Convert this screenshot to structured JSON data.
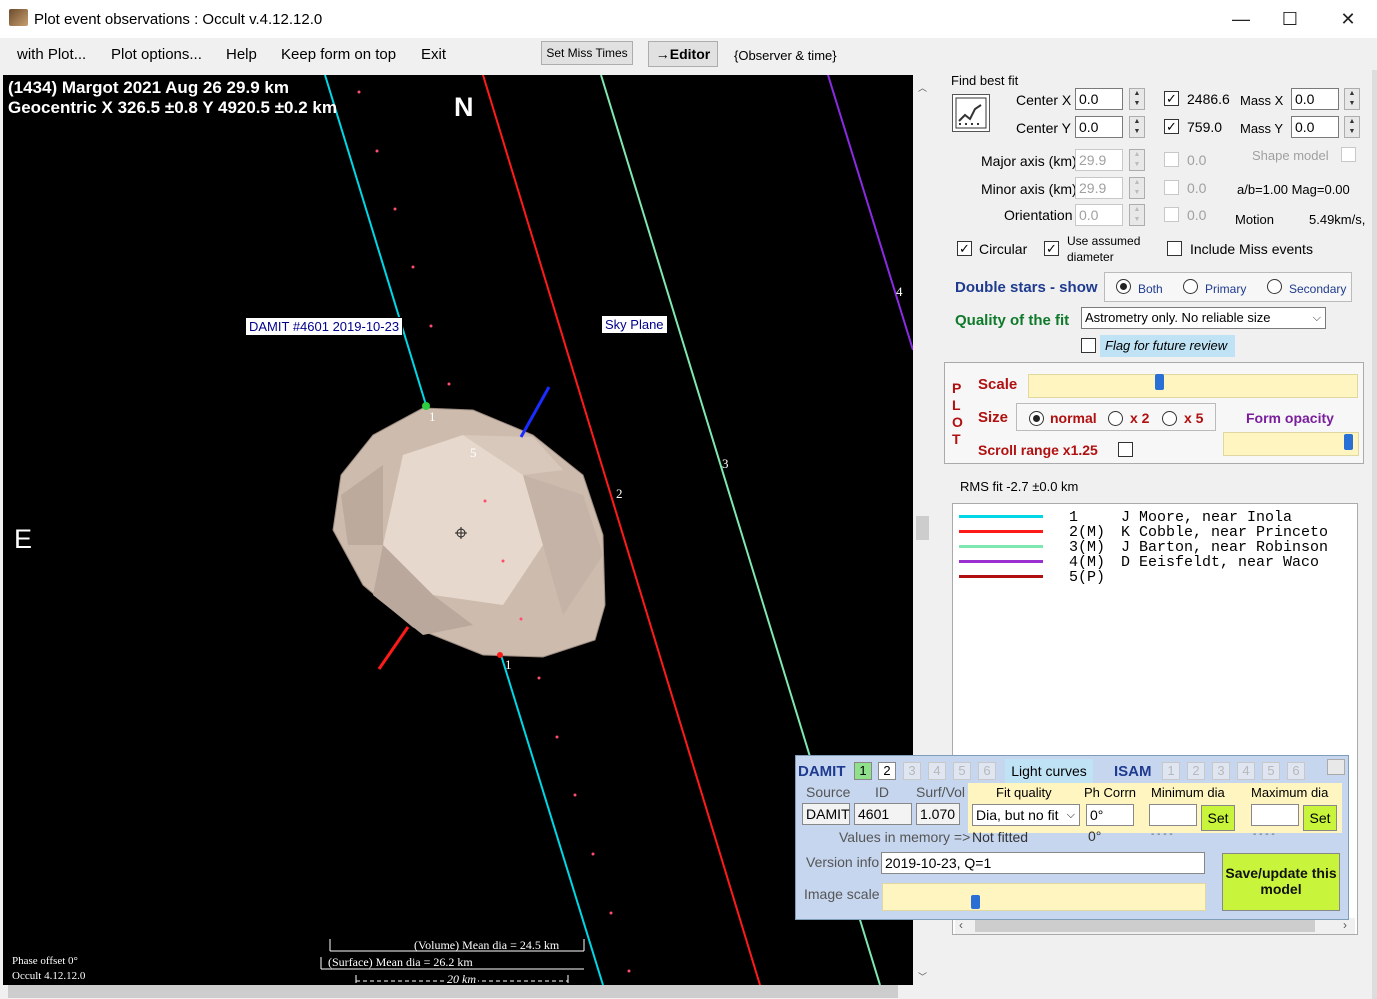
{
  "window": {
    "title": "Plot event observations : Occult v.4.12.12.0",
    "minimize": "—",
    "maximize": "☐",
    "close": "✕"
  },
  "menu": {
    "items": [
      "with Plot...",
      "Plot options...",
      "Help",
      "Keep form on top",
      "Exit"
    ],
    "set_miss_times": "Set Miss Times",
    "editor": "→Editor",
    "observer_time": "{Observer & time}"
  },
  "plot": {
    "header_line1": "(1434) Margot  2021 Aug 26   29.9 km",
    "header_line2": "Geocentric  X  326.5 ±0.8  Y 4920.5 ±0.2 km",
    "north": "N",
    "east": "E",
    "damit_label": "DAMIT #4601 2019-10-23",
    "sky_plane": "Sky Plane",
    "chord_labels": [
      "1",
      "2",
      "3",
      "4",
      "5",
      "1"
    ],
    "volume_dia": "(Volume) Mean dia = 24.5 km",
    "surface_dia": "(Surface) Mean dia = 26.2 km",
    "scale_bar": "20 km",
    "phase_offset": "Phase offset 0°",
    "version": "Occult 4.12.12.0",
    "colors": {
      "chord1": "#00d7e6",
      "chord2": "#ff1a1a",
      "chord3": "#7fe8b0",
      "chord4": "#8a2be2",
      "asteroid": "#cdbcae"
    }
  },
  "fit": {
    "find_best_fit": "Find best fit",
    "center_x_label": "Center X",
    "center_x": "0.0",
    "center_y_label": "Center Y",
    "center_y": "0.0",
    "val_x": "2486.6",
    "val_y": "759.0",
    "mass_x_label": "Mass X",
    "mass_x": "0.0",
    "mass_y_label": "Mass Y",
    "mass_y": "0.0",
    "major_axis_label": "Major axis (km)",
    "major_axis": "29.9",
    "minor_axis_label": "Minor axis (km)",
    "minor_axis": "29.9",
    "orientation_label": "Orientation",
    "orientation": "0.0",
    "dim_vals": [
      "0.0",
      "0.0",
      "0.0"
    ],
    "shape_model": "Shape model",
    "ab_mag": "a/b=1.00  Mag=0.00",
    "motion_label": "Motion",
    "motion": "5.49km/s,",
    "circular": "Circular",
    "use_assumed": "Use assumed",
    "diameter": "diameter",
    "include_miss": "Include Miss events"
  },
  "double_stars": {
    "label": "Double stars - show",
    "both": "Both",
    "primary": "Primary",
    "secondary": "Secondary"
  },
  "quality": {
    "label": "Quality of the fit",
    "value": "Astrometry only. No reliable size",
    "flag": "Flag for future review"
  },
  "plot_box": {
    "plot_letters": [
      "P",
      "L",
      "O",
      "T"
    ],
    "scale": "Scale",
    "size": "Size",
    "normal": "normal",
    "x2": "x 2",
    "x5": "x 5",
    "form_opacity": "Form opacity",
    "scroll_range": "Scroll range x1.25"
  },
  "rms": "RMS fit -2.7 ±0.0 km",
  "legend": [
    {
      "num": "1    ",
      "name": "J Moore, near Inola",
      "color": "#00d7e6"
    },
    {
      "num": "2(M) ",
      "name": "K Cobble, near Princeto",
      "color": "#ff1a1a"
    },
    {
      "num": "3(M) ",
      "name": "J Barton, near Robinson",
      "color": "#7fe8b0"
    },
    {
      "num": "4(M) ",
      "name": "D Eeisfeldt, near Waco",
      "color": "#9b30d0"
    },
    {
      "num": "5(P) ",
      "name": "",
      "color": "#b01010"
    }
  ],
  "damit": {
    "title": "DAMIT",
    "tabs": [
      "1",
      "2",
      "3",
      "4",
      "5",
      "6"
    ],
    "light_curves": "Light curves",
    "isam": "ISAM",
    "isam_tabs": [
      "1",
      "2",
      "3",
      "4",
      "5",
      "6"
    ],
    "source_label": "Source",
    "id_label": "ID",
    "surf_vol_label": "Surf/Vol",
    "source": "DAMIT",
    "id": "4601",
    "surf_vol": "1.070",
    "fit_quality_label": "Fit quality",
    "ph_corrn_label": "Ph Corrn",
    "min_dia_label": "Minimum dia",
    "max_dia_label": "Maximum dia",
    "fit_quality": "Dia, but no fit",
    "ph_corrn": "0°",
    "set": "Set",
    "values_in_memory": "Values in memory =>",
    "not_fitted": "Not fitted",
    "ph_mem": "0°",
    "dashes": "- - - -",
    "version_info_label": "Version info",
    "version_info": "2019-10-23, Q=1",
    "image_scale_label": "Image scale",
    "save_update": "Save/update this model"
  }
}
